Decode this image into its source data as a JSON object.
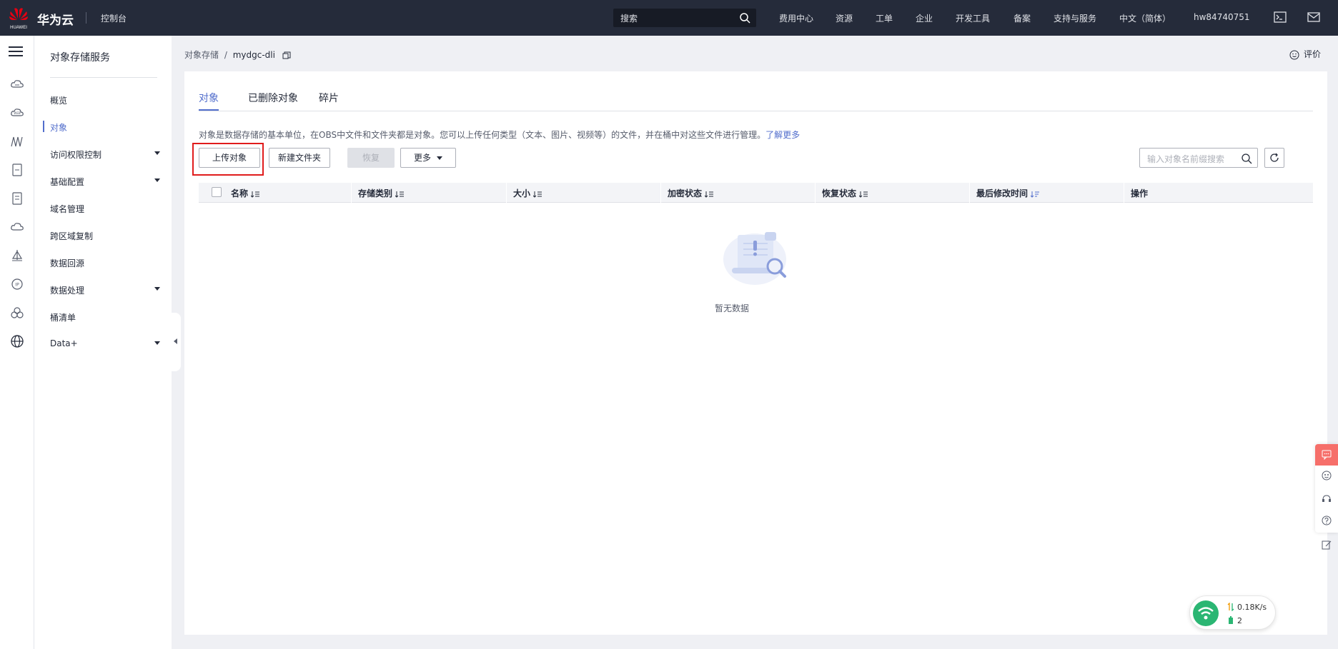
{
  "topbar": {
    "logo_text": "HUAWEI",
    "brand": "华为云",
    "console": "控制台",
    "search_placeholder": "搜索",
    "nav": [
      "费用中心",
      "资源",
      "工单",
      "企业",
      "开发工具",
      "备案",
      "支持与服务",
      "中文（简体）",
      "hw84740751"
    ]
  },
  "sidebar": {
    "title": "对象存储服务",
    "items": [
      {
        "label": "概览",
        "expandable": false
      },
      {
        "label": "对象",
        "expandable": false,
        "active": true
      },
      {
        "label": "访问权限控制",
        "expandable": true
      },
      {
        "label": "基础配置",
        "expandable": true
      },
      {
        "label": "域名管理",
        "expandable": false
      },
      {
        "label": "跨区域复制",
        "expandable": false
      },
      {
        "label": "数据回源",
        "expandable": false
      },
      {
        "label": "数据处理",
        "expandable": true
      },
      {
        "label": "桶清单",
        "expandable": false
      },
      {
        "label": "Data+",
        "expandable": true
      }
    ]
  },
  "breadcrumb": {
    "parent": "对象存储",
    "separator": "/",
    "current": "mydgc-dli"
  },
  "rate_label": "评价",
  "tabs": [
    "对象",
    "已删除对象",
    "碎片"
  ],
  "description": {
    "text": "对象是数据存储的基本单位，在OBS中文件和文件夹都是对象。您可以上传任何类型（文本、图片、视频等）的文件，并在桶中对这些文件进行管理。",
    "link": "了解更多"
  },
  "toolbar": {
    "upload": "上传对象",
    "new_folder": "新建文件夹",
    "restore": "恢复",
    "more": "更多",
    "search_placeholder": "输入对象名前缀搜索"
  },
  "table": {
    "columns": [
      "名称",
      "存储类别",
      "大小",
      "加密状态",
      "恢复状态",
      "最后修改时间",
      "操作"
    ],
    "empty_text": "暂无数据"
  },
  "network": {
    "speed": "0.18K/s",
    "count": "2"
  },
  "colors": {
    "topbar": "#252b3a",
    "accent": "#526ecc",
    "highlight": "#e01c1c",
    "float_accent": "#f66f6a",
    "wifi": "#2bb673"
  }
}
